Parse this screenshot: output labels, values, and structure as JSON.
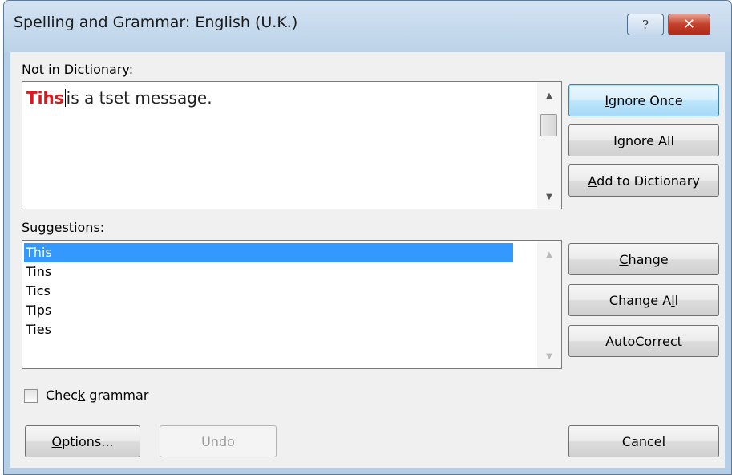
{
  "window": {
    "title": "Spelling and Grammar: English (U.K.)",
    "help_glyph": "?",
    "close_glyph": "✕"
  },
  "not_in_dictionary": {
    "label_prefix": "Not in Dictionary",
    "label_accel": ":",
    "misspelled_word": "Tihs",
    "rest_text": "is a tset message."
  },
  "suggestions": {
    "label_prefix": "Suggestio",
    "label_accel": "n",
    "label_suffix": "s:",
    "items": [
      "This",
      "Tins",
      "Tics",
      "Tips",
      "Ties"
    ],
    "selected": "This"
  },
  "buttons": {
    "ignore_once": {
      "accel": "I",
      "rest": "gnore Once"
    },
    "ignore_all": {
      "before": "I",
      "accel": "g",
      "rest": "nore All"
    },
    "add_to_dictionary": {
      "accel": "A",
      "rest": "dd to Dictionary"
    },
    "change": {
      "accel": "C",
      "rest": "hange"
    },
    "change_all": {
      "before": "Change A",
      "accel": "l",
      "rest": "l"
    },
    "autocorrect": {
      "before": "AutoCo",
      "accel": "r",
      "rest": "rect"
    },
    "options": {
      "accel": "O",
      "rest": "ptions..."
    },
    "undo": "Undo",
    "cancel": "Cancel"
  },
  "check_grammar": {
    "before": "Chec",
    "accel": "k",
    "rest": " grammar",
    "checked": false
  }
}
